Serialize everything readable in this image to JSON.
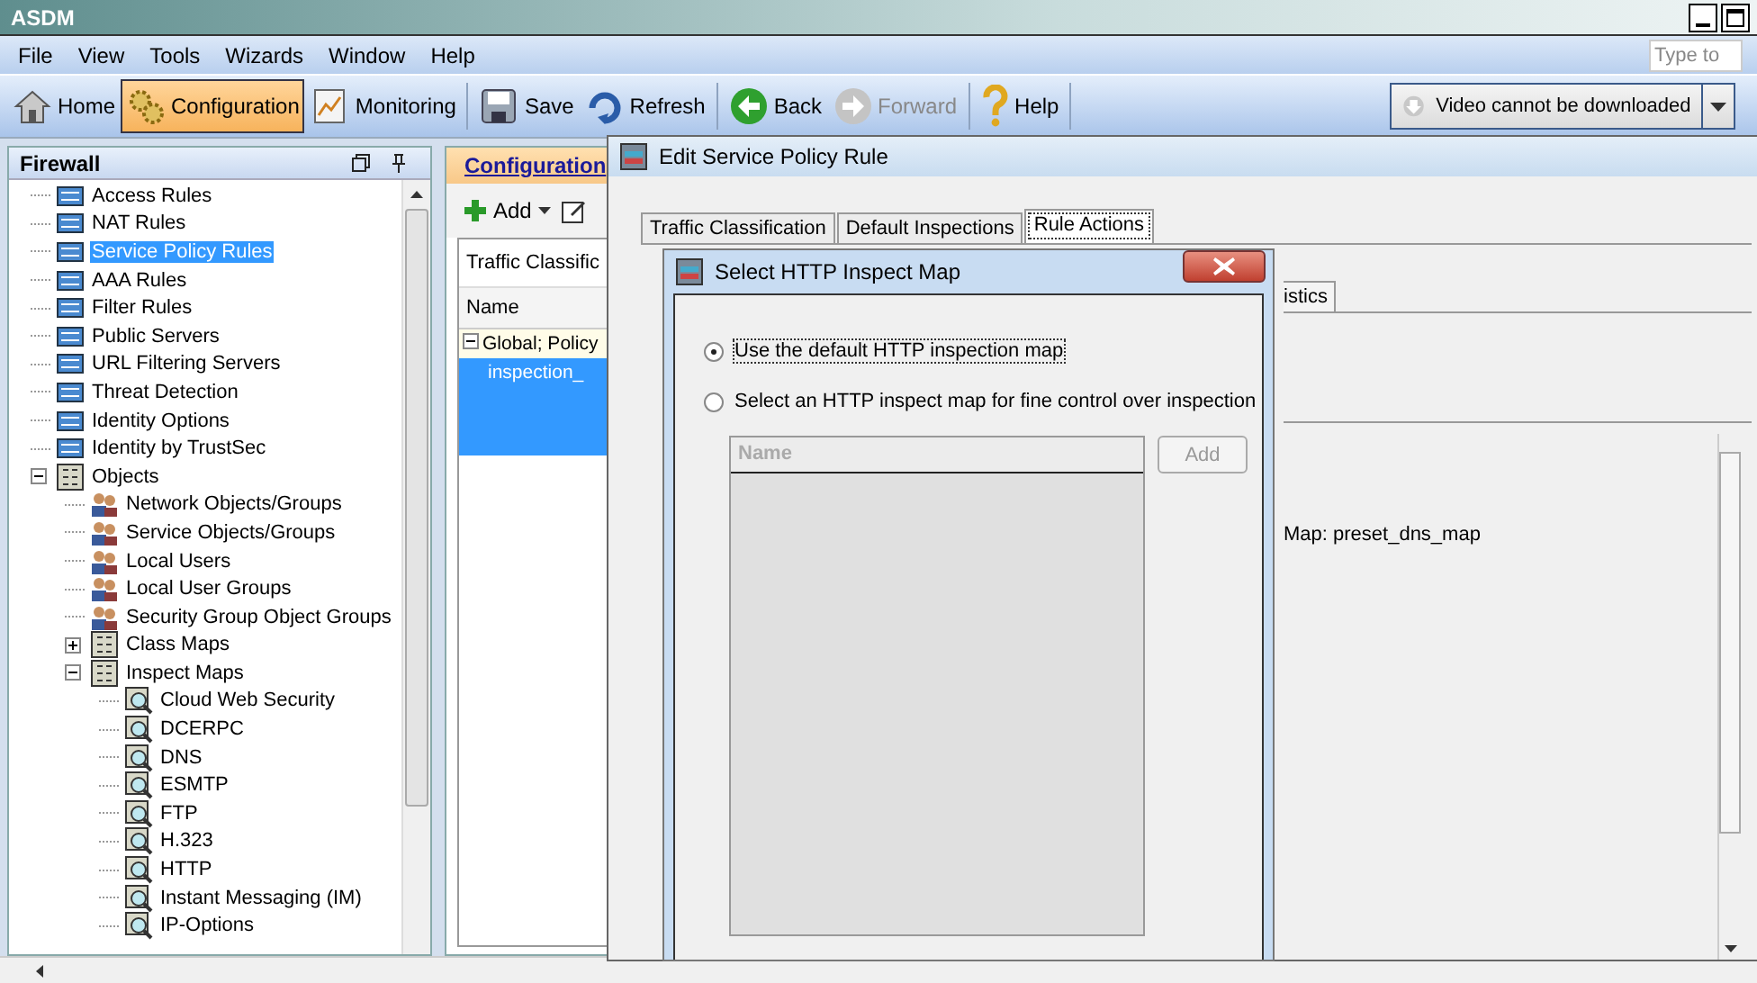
{
  "window": {
    "title": "ASDM"
  },
  "menu": [
    "File",
    "View",
    "Tools",
    "Wizards",
    "Window",
    "Help"
  ],
  "search": {
    "placeholder": "Type to"
  },
  "toolbar": [
    {
      "label": "Home",
      "kind": "home",
      "selected": false,
      "disabled": false
    },
    {
      "label": "Configuration",
      "kind": "gears",
      "selected": true,
      "disabled": false
    },
    {
      "label": "Monitoring",
      "kind": "chart",
      "selected": false,
      "disabled": false
    },
    {
      "label": "Save",
      "kind": "save",
      "selected": false,
      "disabled": false
    },
    {
      "label": "Refresh",
      "kind": "refresh",
      "selected": false,
      "disabled": false
    },
    {
      "label": "Back",
      "kind": "back",
      "selected": false,
      "disabled": false
    },
    {
      "label": "Forward",
      "kind": "forward",
      "selected": false,
      "disabled": true
    },
    {
      "label": "Help",
      "kind": "help",
      "selected": false,
      "disabled": false
    }
  ],
  "video_button": {
    "label": "Video cannot be downloaded"
  },
  "sidebar": {
    "title": "Firewall",
    "items": [
      {
        "label": "Access Rules",
        "selected": false
      },
      {
        "label": "NAT Rules",
        "selected": false
      },
      {
        "label": "Service Policy Rules",
        "selected": true
      },
      {
        "label": "AAA Rules",
        "selected": false
      },
      {
        "label": "Filter Rules",
        "selected": false
      },
      {
        "label": "Public Servers",
        "selected": false
      },
      {
        "label": "URL Filtering Servers",
        "selected": false
      },
      {
        "label": "Threat Detection",
        "selected": false
      },
      {
        "label": "Identity Options",
        "selected": false
      },
      {
        "label": "Identity by TrustSec",
        "selected": false
      },
      {
        "label": "Objects",
        "selected": false,
        "expanded": true,
        "children": [
          {
            "label": "Network Objects/Groups",
            "selected": false
          },
          {
            "label": "Service Objects/Groups",
            "selected": false
          },
          {
            "label": "Local Users",
            "selected": false
          },
          {
            "label": "Local User Groups",
            "selected": false
          },
          {
            "label": "Security Group Object Groups",
            "selected": false
          },
          {
            "label": "Class Maps",
            "selected": false,
            "expanded": false
          },
          {
            "label": "Inspect Maps",
            "selected": false,
            "expanded": true,
            "children": [
              {
                "label": "Cloud Web Security",
                "selected": false
              },
              {
                "label": "DCERPC",
                "selected": false
              },
              {
                "label": "DNS",
                "selected": false
              },
              {
                "label": "ESMTP",
                "selected": false
              },
              {
                "label": "FTP",
                "selected": false
              },
              {
                "label": "H.323",
                "selected": false
              },
              {
                "label": "HTTP",
                "selected": false
              },
              {
                "label": "Instant Messaging (IM)",
                "selected": false
              },
              {
                "label": "IP-Options",
                "selected": false
              }
            ]
          }
        ]
      }
    ]
  },
  "config_panel": {
    "tab": "Configuration",
    "add_label": "Add",
    "header": "Traffic Classific",
    "column": "Name",
    "rows": [
      {
        "text": "Global; Policy",
        "selected": false,
        "expanded": true
      },
      {
        "text": "inspection_",
        "selected": true
      }
    ]
  },
  "edit_dialog": {
    "title": "Edit Service Policy Rule",
    "tabs": [
      {
        "label": "Traffic Classification",
        "selected": false
      },
      {
        "label": "Default Inspections",
        "selected": false
      },
      {
        "label": "Rule Actions",
        "selected": true
      }
    ],
    "subtab": "istics",
    "detail": "Map: preset_dns_map"
  },
  "http_dialog": {
    "title": "Select HTTP Inspect Map",
    "options": [
      {
        "label": "Use the default HTTP inspection map",
        "selected": true
      },
      {
        "label": "Select an HTTP inspect map for fine control over inspection",
        "selected": false
      }
    ],
    "column": "Name",
    "add_button": {
      "label": "Add",
      "disabled": true
    }
  }
}
